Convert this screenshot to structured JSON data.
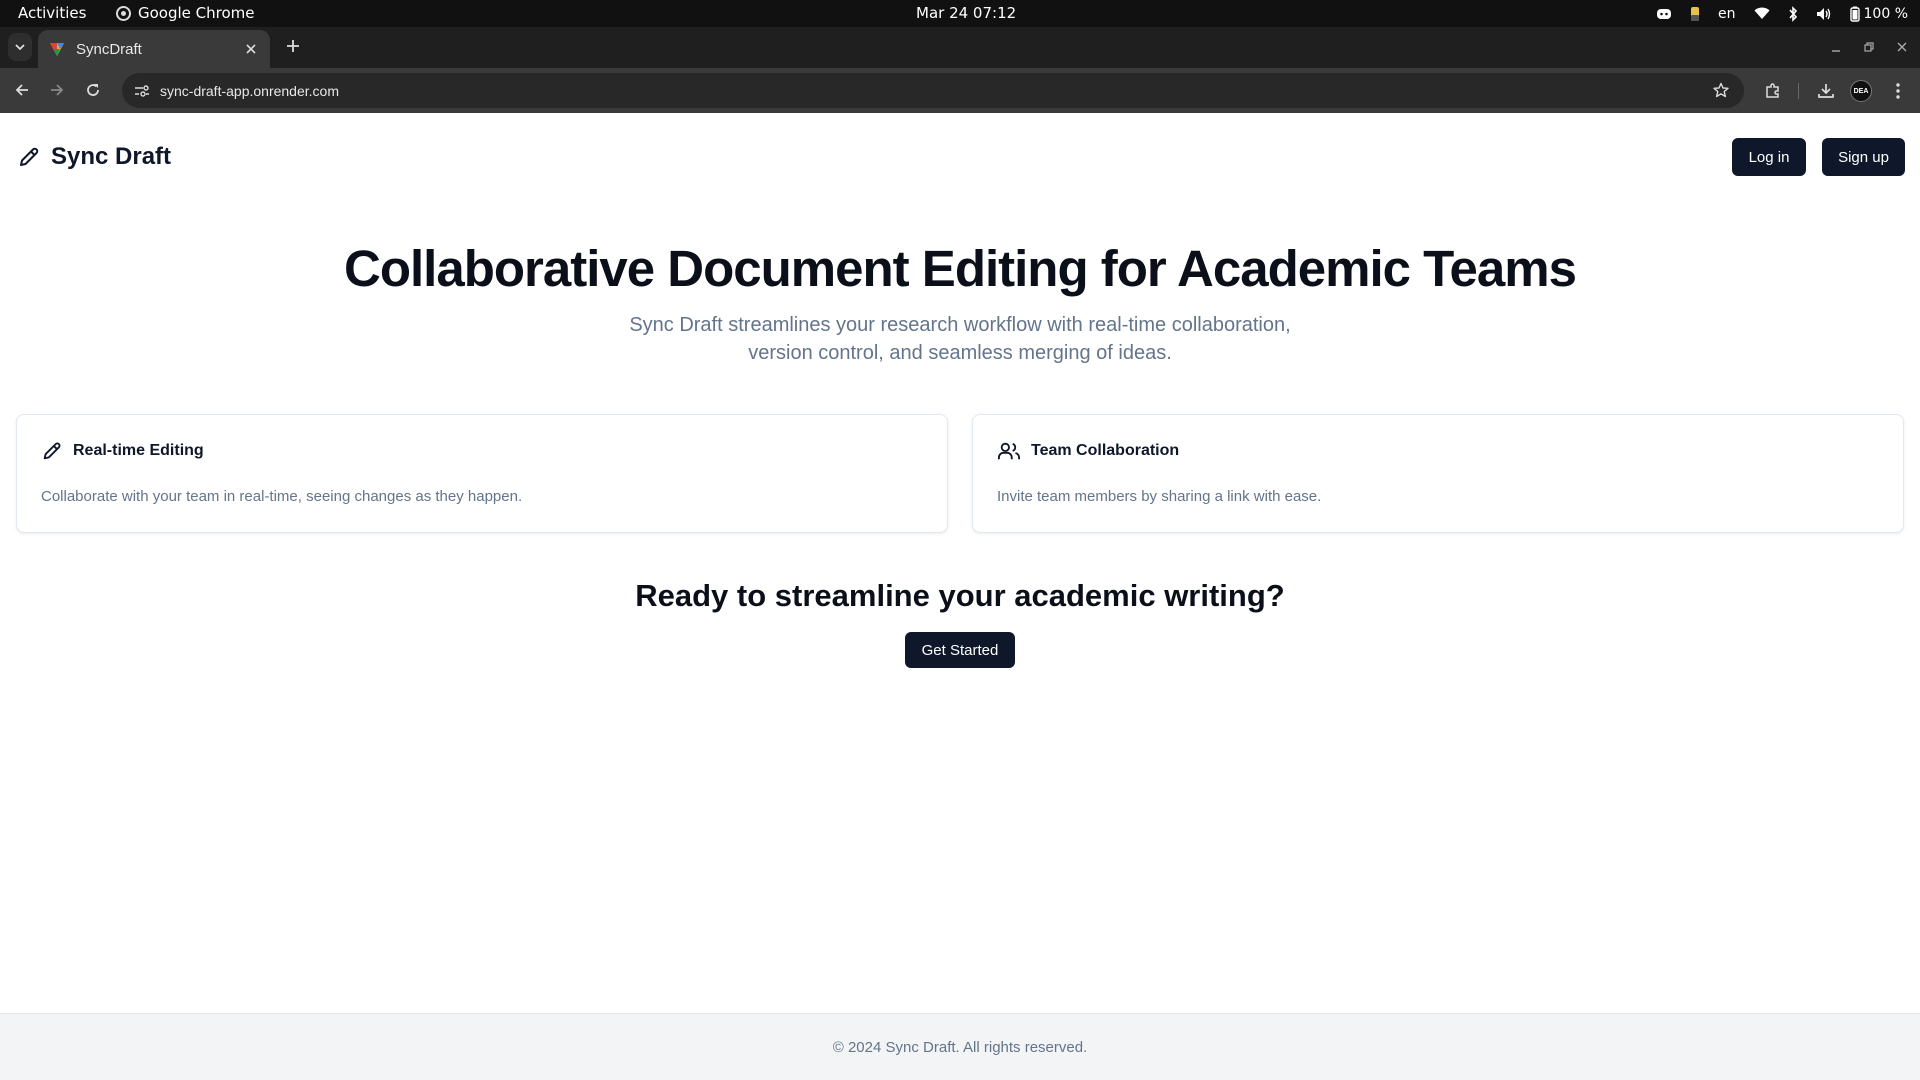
{
  "os": {
    "activities": "Activities",
    "app_name": "Google Chrome",
    "clock": "Mar 24  07:12",
    "language": "en",
    "battery": "100 %"
  },
  "browser": {
    "tab_title": "SyncDraft",
    "url": "sync-draft-app.onrender.com",
    "profile_initials": "DEA"
  },
  "site": {
    "brand": "Sync Draft",
    "login_label": "Log in",
    "signup_label": "Sign up",
    "hero_title": "Collaborative Document Editing for Academic Teams",
    "hero_subtitle": "Sync Draft streamlines your research workflow with real-time collaboration, version control, and seamless merging of ideas.",
    "features": [
      {
        "icon": "pencil-icon",
        "title": "Real-time Editing",
        "description": "Collaborate with your team in real-time, seeing changes as they happen."
      },
      {
        "icon": "users-icon",
        "title": "Team Collaboration",
        "description": "Invite team members by sharing a link with ease."
      }
    ],
    "cta_title": "Ready to streamline your academic writing?",
    "cta_button": "Get Started",
    "footer": "© 2024 Sync Draft. All rights reserved."
  },
  "colors": {
    "primary": "#0f172a",
    "muted_text": "#64748b",
    "footer_bg": "#f3f4f6"
  }
}
